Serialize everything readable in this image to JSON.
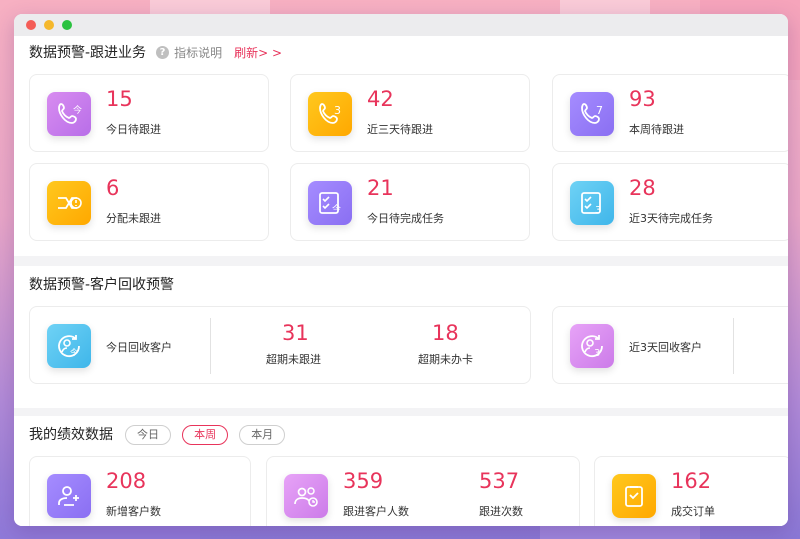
{
  "window": {
    "controls": [
      "close",
      "minimize",
      "maximize"
    ]
  },
  "colors": {
    "accent": "#e8345b"
  },
  "followup": {
    "title": "数据预警-跟进业务",
    "help_label": "指标说明",
    "refresh_label": "刷新> >",
    "cards": [
      {
        "value": "15",
        "label": "今日待跟进",
        "icon": "phone-today-icon",
        "color": "purple"
      },
      {
        "value": "42",
        "label": "近三天待跟进",
        "icon": "phone-3days-icon",
        "color": "yellow"
      },
      {
        "value": "93",
        "label": "本周待跟进",
        "icon": "phone-week-icon",
        "color": "violet"
      },
      {
        "value": "6",
        "label": "分配未跟进",
        "icon": "assign-alert-icon",
        "color": "yellow"
      },
      {
        "value": "21",
        "label": "今日待完成任务",
        "icon": "task-today-icon",
        "color": "violet"
      },
      {
        "value": "28",
        "label": "近3天待完成任务",
        "icon": "task-3days-icon",
        "color": "cyan"
      }
    ]
  },
  "recycle": {
    "title": "数据预警-客户回收预警",
    "groups": [
      {
        "label": "今日回收客户",
        "icon": "customer-recycle-today-icon",
        "stats": [
          {
            "value": "31",
            "label": "超期未跟进"
          },
          {
            "value": "18",
            "label": "超期未办卡"
          }
        ]
      },
      {
        "label": "近3天回收客户",
        "icon": "customer-recycle-3days-icon",
        "stats": []
      }
    ]
  },
  "performance": {
    "title": "我的绩效数据",
    "tabs": [
      {
        "label": "今日",
        "active": false
      },
      {
        "label": "本周",
        "active": true
      },
      {
        "label": "本月",
        "active": false
      }
    ],
    "cards": [
      {
        "stats": [
          {
            "value": "208",
            "label": "新增客户数"
          }
        ],
        "icon": "add-customer-icon"
      },
      {
        "stats": [
          {
            "value": "359",
            "label": "跟进客户人数"
          },
          {
            "value": "537",
            "label": "跟进次数"
          }
        ],
        "icon": "followup-customers-icon"
      },
      {
        "stats": [
          {
            "value": "162",
            "label": "成交订单"
          }
        ],
        "icon": "order-icon"
      }
    ]
  }
}
